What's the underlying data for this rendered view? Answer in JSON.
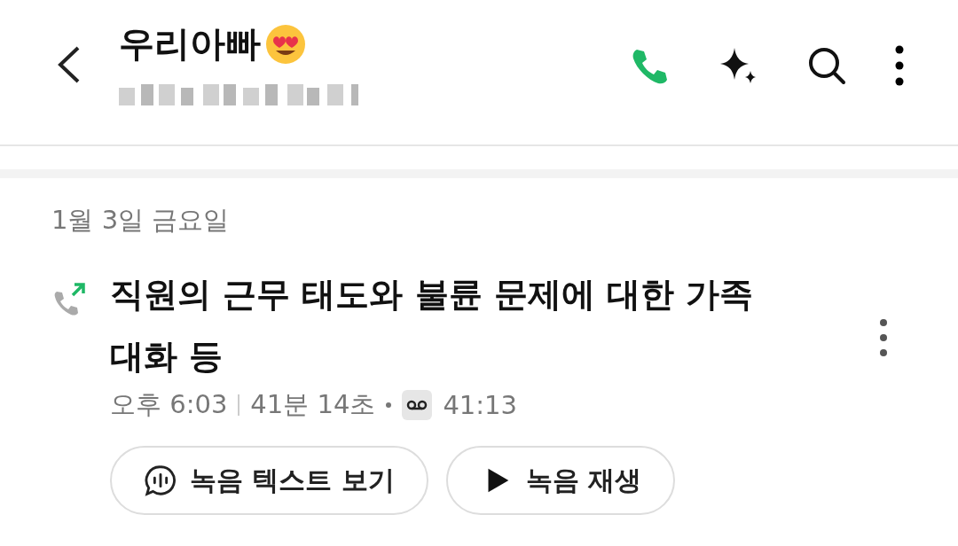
{
  "header": {
    "title": "우리아빠"
  },
  "date": "1월 3일 금요일",
  "call": {
    "title": "직원의 근무 태도와 불륜 문제에 대한 가족 대화 등",
    "time": "오후 6:03",
    "duration": "41분 14초",
    "recording_length": "41:13"
  },
  "buttons": [
    {
      "kind": "transcript",
      "label": "녹음 텍스트 보기"
    },
    {
      "kind": "play",
      "label": "녹음 재생"
    }
  ]
}
